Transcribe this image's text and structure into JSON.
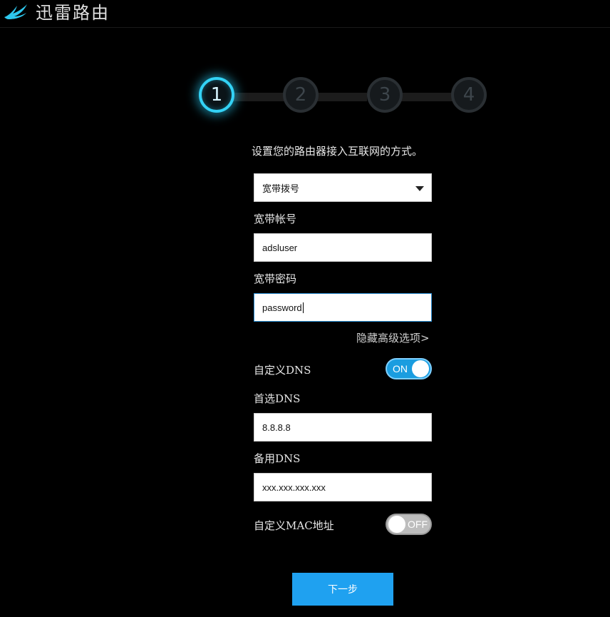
{
  "app": {
    "title": "迅雷路由",
    "logo_icon": "thunder-bird-logo"
  },
  "steps": [
    {
      "number": "1",
      "state": "active"
    },
    {
      "number": "2",
      "state": "inactive"
    },
    {
      "number": "3",
      "state": "inactive"
    },
    {
      "number": "4",
      "state": "inactive"
    }
  ],
  "form": {
    "instruction": "设置您的路由器接入互联网的方式。",
    "connection_type": {
      "selected": "宽带拨号",
      "icon": "dropdown-arrow-icon"
    },
    "account": {
      "label": "宽带帐号",
      "value": "adsluser"
    },
    "password": {
      "label": "宽带密码",
      "value": "password"
    },
    "advanced_link": "隐藏高级选项>",
    "custom_dns": {
      "label": "自定义DNS",
      "toggle_text": "ON",
      "enabled": true
    },
    "primary_dns": {
      "label": "首选DNS",
      "value": "8.8.8.8"
    },
    "secondary_dns": {
      "label": "备用DNS",
      "placeholder": "xxx.xxx.xxx.xxx"
    },
    "custom_mac": {
      "label": "自定义MAC地址",
      "toggle_text": "OFF",
      "enabled": false
    },
    "next_button": "下一步"
  },
  "colors": {
    "background": "#000000",
    "accent": "#1fa1f0",
    "step_active": "#33d2f5",
    "toggle_on": "#1a9de0",
    "toggle_off": "#bdbdbd"
  }
}
